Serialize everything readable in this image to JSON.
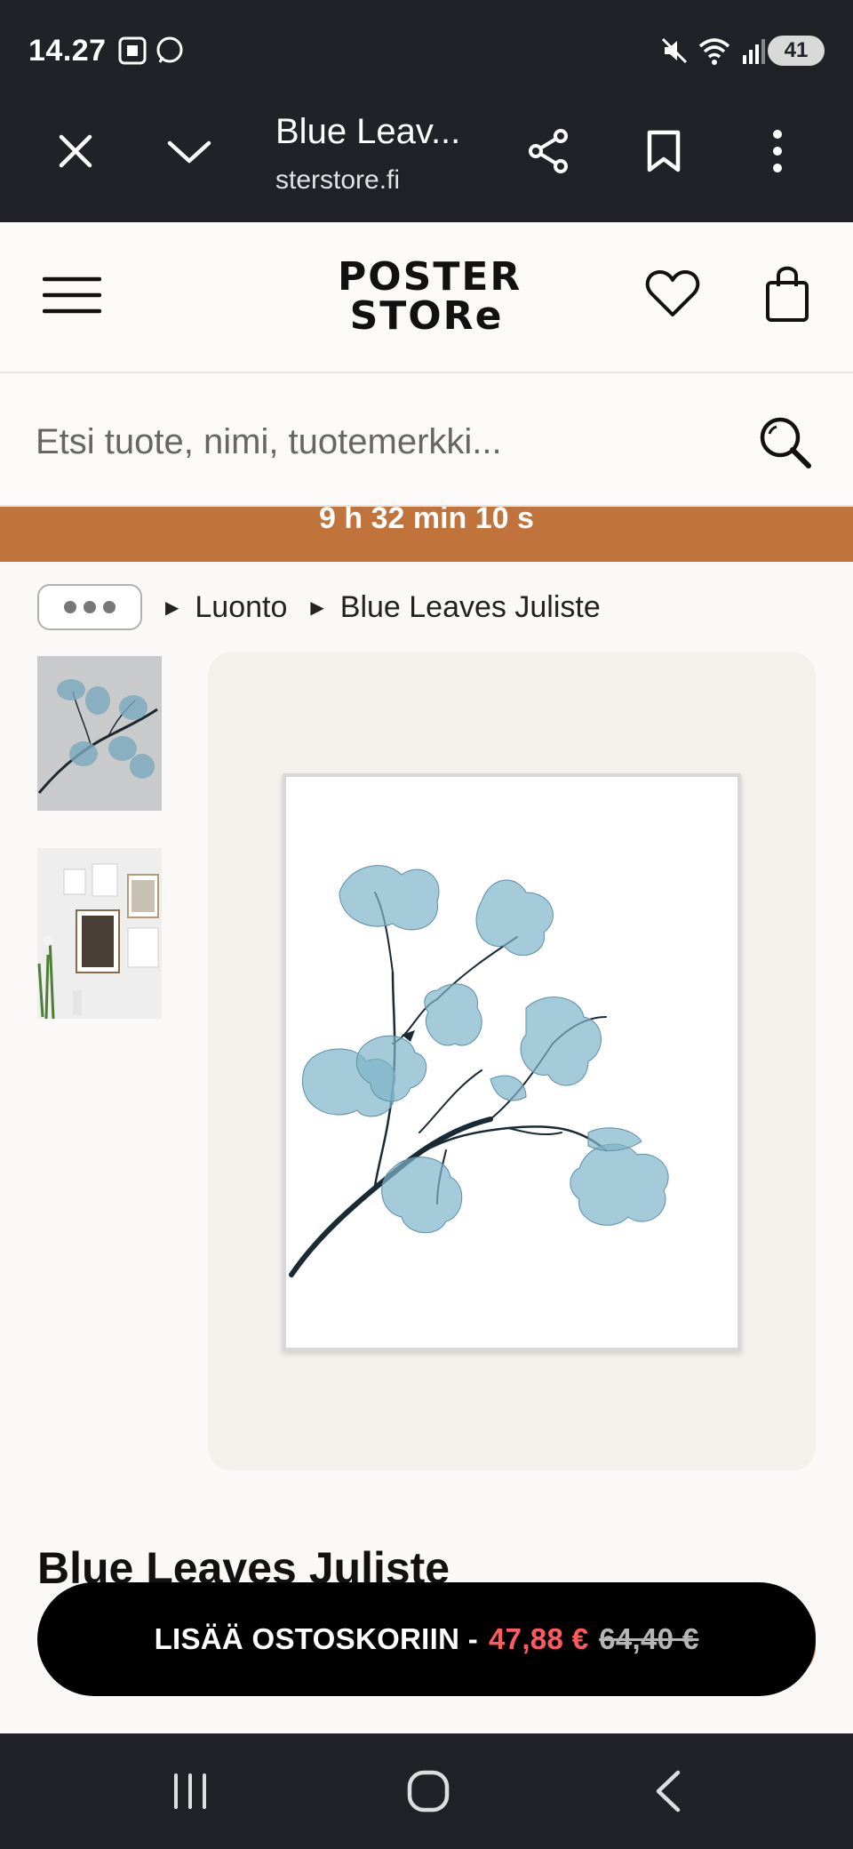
{
  "status_bar": {
    "time": "14.27",
    "battery": "41"
  },
  "browser": {
    "tab_title": "Blue Leav...",
    "url": "sterstore.fi"
  },
  "site": {
    "logo_line1": "POSTER",
    "logo_line2": "STORe"
  },
  "search": {
    "placeholder": "Etsi tuote, nimi, tuotemerkki..."
  },
  "countdown": {
    "text": "9 h 32 min 10 s"
  },
  "breadcrumb": {
    "items": [
      "Luonto",
      "Blue Leaves Juliste"
    ]
  },
  "product": {
    "title": "Blue Leaves Juliste"
  },
  "cta": {
    "label": "LISÄÄ OSTOSKORIIN -",
    "price": "47,88 €",
    "old_price": "64,40 €"
  },
  "colors": {
    "chrome_bg": "#212228",
    "banner": "#c0733b",
    "price": "#ff5a5f",
    "leaf_blue": "#7fb3c9"
  }
}
